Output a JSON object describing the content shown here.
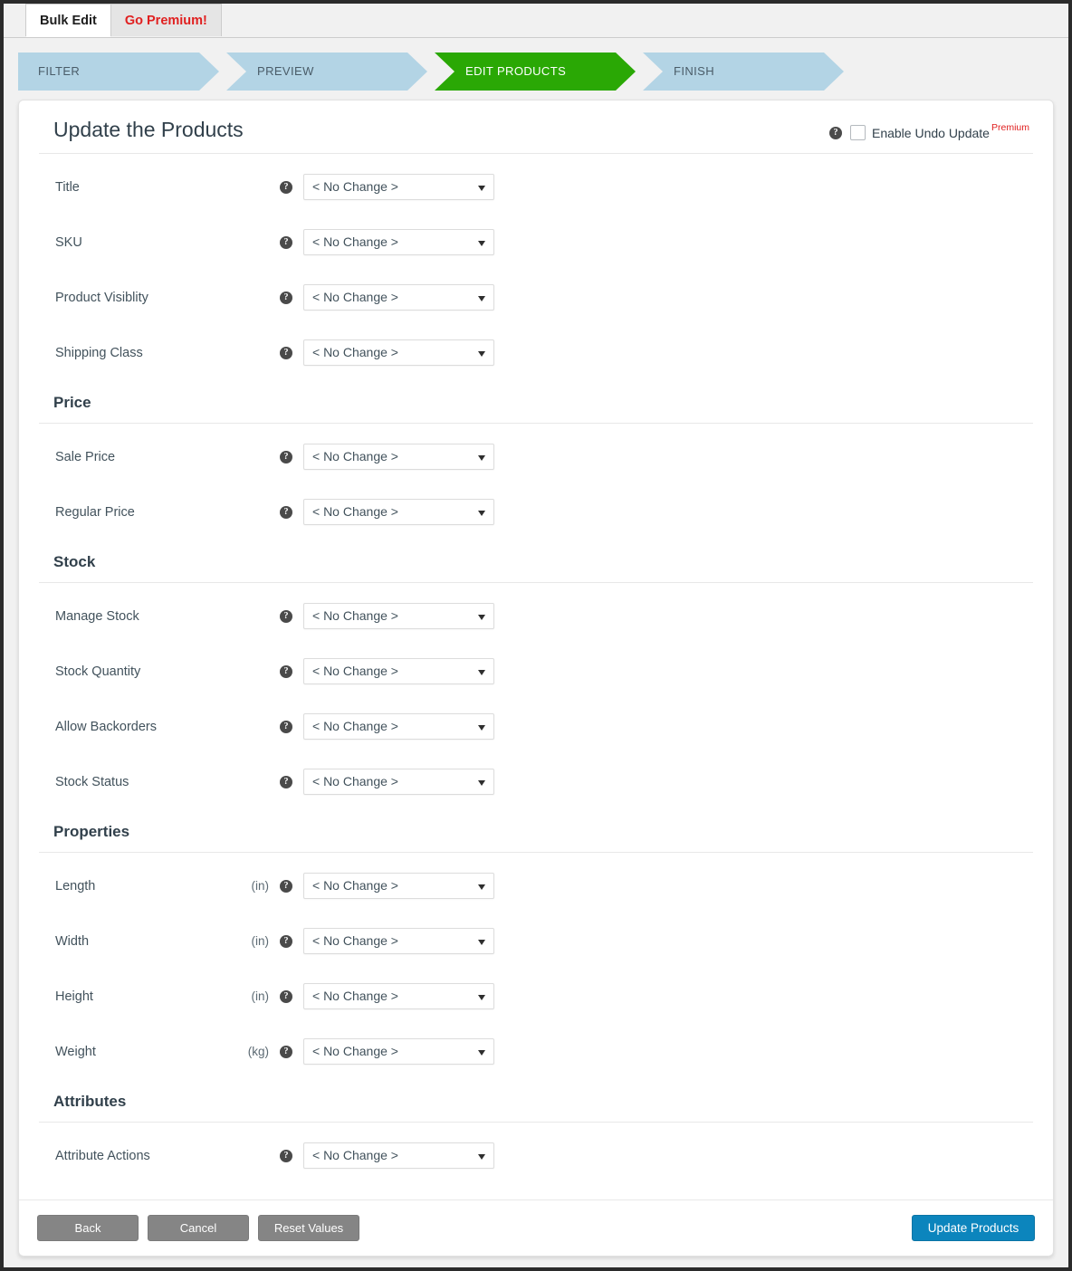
{
  "tabs": [
    {
      "label": "Bulk Edit",
      "active": true
    },
    {
      "label": "Go Premium!",
      "active": false
    }
  ],
  "steps": [
    {
      "label": "FILTER",
      "active": false
    },
    {
      "label": "PREVIEW",
      "active": false
    },
    {
      "label": "EDIT PRODUCTS",
      "active": true
    },
    {
      "label": "FINISH",
      "active": false
    }
  ],
  "header": {
    "title": "Update the Products",
    "undo_label": "Enable Undo Update",
    "premium_badge": "Premium",
    "help_glyph": "?"
  },
  "select_value": "< No Change >",
  "fields": [
    {
      "label": "Title",
      "unit": "",
      "value": "< No Change >"
    },
    {
      "label": "SKU",
      "unit": "",
      "value": "< No Change >"
    },
    {
      "label": "Product Visiblity",
      "unit": "",
      "value": "< No Change >"
    },
    {
      "label": "Shipping Class",
      "unit": "",
      "value": "< No Change >"
    }
  ],
  "sections": [
    {
      "title": "Price",
      "fields": [
        {
          "label": "Sale Price",
          "unit": "",
          "value": "< No Change >"
        },
        {
          "label": "Regular Price",
          "unit": "",
          "value": "< No Change >"
        }
      ]
    },
    {
      "title": "Stock",
      "fields": [
        {
          "label": "Manage Stock",
          "unit": "",
          "value": "< No Change >"
        },
        {
          "label": "Stock Quantity",
          "unit": "",
          "value": "< No Change >"
        },
        {
          "label": "Allow Backorders",
          "unit": "",
          "value": "< No Change >"
        },
        {
          "label": "Stock Status",
          "unit": "",
          "value": "< No Change >"
        }
      ]
    },
    {
      "title": "Properties",
      "fields": [
        {
          "label": "Length",
          "unit": "(in)",
          "value": "< No Change >"
        },
        {
          "label": "Width",
          "unit": "(in)",
          "value": "< No Change >"
        },
        {
          "label": "Height",
          "unit": "(in)",
          "value": "< No Change >"
        },
        {
          "label": "Weight",
          "unit": "(kg)",
          "value": "< No Change >"
        }
      ]
    },
    {
      "title": "Attributes",
      "fields": [
        {
          "label": "Attribute Actions",
          "unit": "",
          "value": "< No Change >"
        }
      ]
    }
  ],
  "footer": {
    "back_label": "Back",
    "cancel_label": "Cancel",
    "reset_label": "Reset Values",
    "update_label": "Update Products"
  },
  "colors": {
    "step_active": "#2aa805",
    "step_inactive": "#b3d4e5",
    "primary_button": "#0c85bd",
    "premium_red": "#e02020",
    "secondary_button": "#858585"
  }
}
